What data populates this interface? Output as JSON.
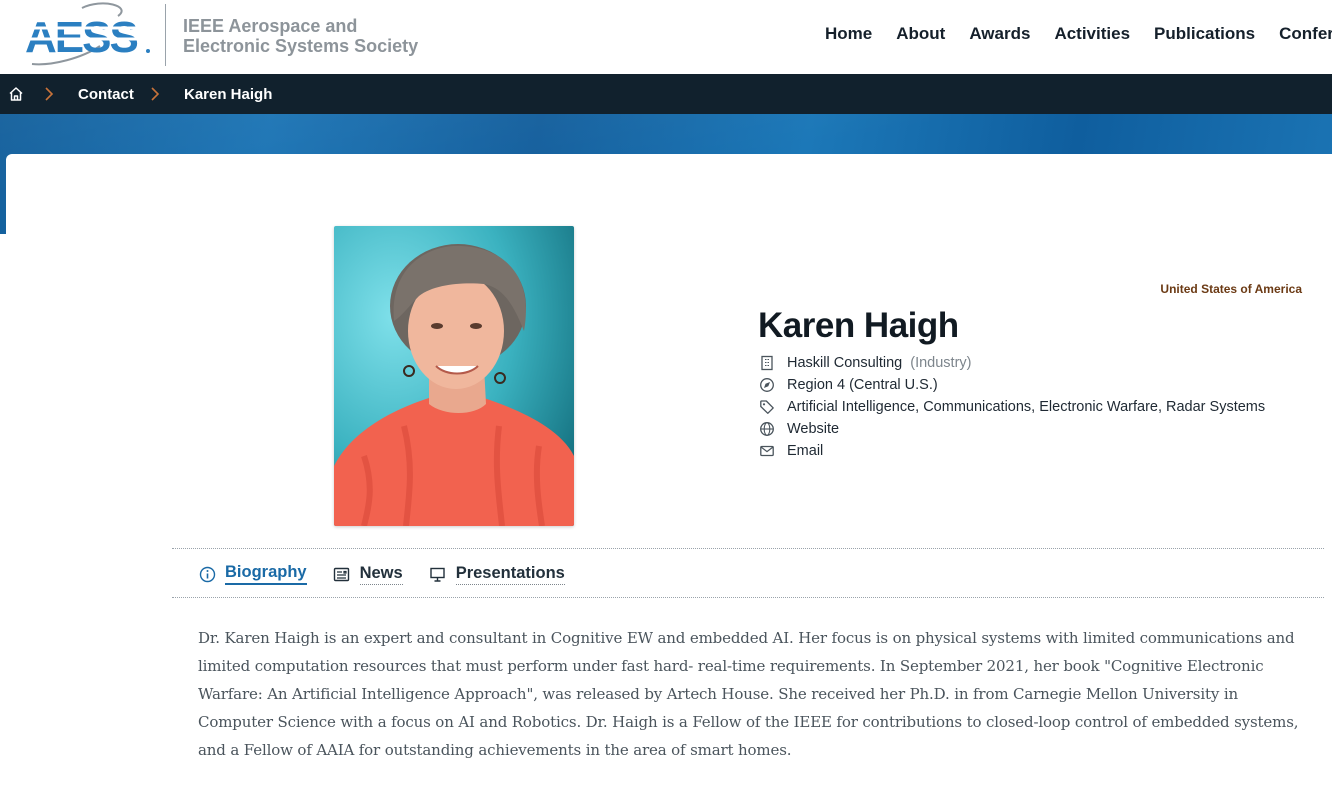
{
  "header": {
    "logo_text": "AESS",
    "society_line1": "IEEE Aerospace and",
    "society_line2": "Electronic Systems Society",
    "nav": [
      "Home",
      "About",
      "Awards",
      "Activities",
      "Publications",
      "Confere"
    ]
  },
  "breadcrumb": {
    "home_icon": "home-icon",
    "items": [
      "Contact",
      "Karen Haigh"
    ]
  },
  "profile": {
    "country": "United States of America",
    "name": "Karen Haigh",
    "company": "Haskill Consulting",
    "company_type": "(Industry)",
    "region": "Region 4 (Central U.S.)",
    "topics": "Artificial Intelligence, Communications, Electronic Warfare, Radar Systems",
    "website_label": "Website",
    "email_label": "Email"
  },
  "tabs": [
    {
      "label": "Biography",
      "icon": "info-icon",
      "active": true
    },
    {
      "label": "News",
      "icon": "newspaper-icon",
      "active": false
    },
    {
      "label": "Presentations",
      "icon": "presentation-icon",
      "active": false
    }
  ],
  "biography": "Dr. Karen Haigh is an expert and consultant in Cognitive EW and embedded AI. Her focus is on physical systems with limited communications and limited computation resources that must perform under fast hard- real-time requirements. In September 2021, her book \"Cognitive Electronic Warfare: An Artificial Intelligence Approach\", was released by Artech House. She received her Ph.D. in from Carnegie Mellon University in Computer Science with a focus on AI and Robotics. Dr. Haigh is a Fellow of the IEEE for contributions to closed-loop control of embedded systems, and a Fellow of AAIA for outstanding achievements in the area of smart homes.",
  "colors": {
    "breadcrumb_bg": "#11212d",
    "brand_blue": "#1a6aa6",
    "country_text": "#6b3a14",
    "band_blue": "#1a73b4"
  }
}
